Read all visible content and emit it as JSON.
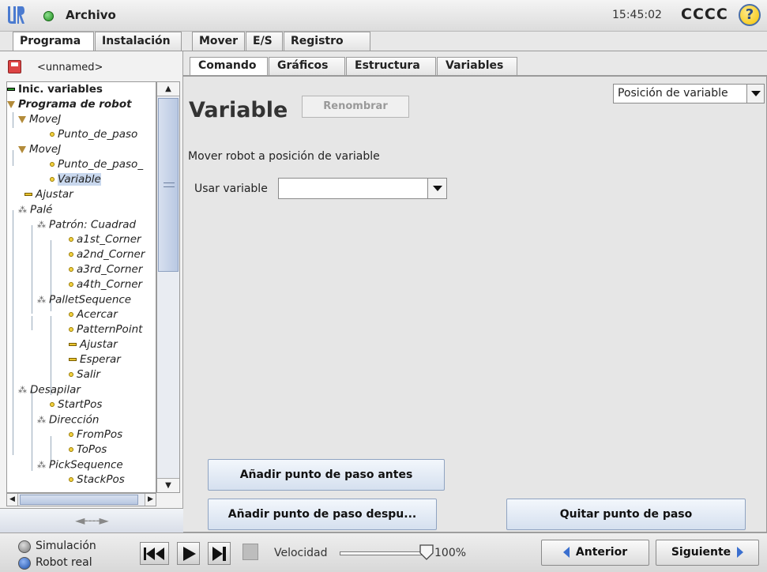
{
  "titlebar": {
    "app_title": "Archivo",
    "clock": "15:45:02",
    "robot_name": "CCCC",
    "help_label": "?"
  },
  "top_tabs": [
    "Programa",
    "Instalación",
    "Mover",
    "E/S",
    "Registro"
  ],
  "file": {
    "name": "<unnamed>"
  },
  "tree": [
    {
      "label": "Inic. variables"
    },
    {
      "label": "Programa de robot"
    },
    {
      "label": "MoveJ"
    },
    {
      "label": "Punto_de_paso"
    },
    {
      "label": "MoveJ"
    },
    {
      "label": "Punto_de_paso_"
    },
    {
      "label": "Variable"
    },
    {
      "label": "Ajustar"
    },
    {
      "label": "Palé"
    },
    {
      "label": "Patrón: Cuadrad"
    },
    {
      "label": "a1st_Corner"
    },
    {
      "label": "a2nd_Corner"
    },
    {
      "label": "a3rd_Corner"
    },
    {
      "label": "a4th_Corner"
    },
    {
      "label": "PalletSequence"
    },
    {
      "label": "Acercar"
    },
    {
      "label": "PatternPoint"
    },
    {
      "label": "Ajustar"
    },
    {
      "label": "Esperar"
    },
    {
      "label": "Salir"
    },
    {
      "label": "Desapilar"
    },
    {
      "label": "StartPos"
    },
    {
      "label": "Dirección"
    },
    {
      "label": "FromPos"
    },
    {
      "label": "ToPos"
    },
    {
      "label": "PickSequence"
    },
    {
      "label": "StackPos"
    }
  ],
  "collapse_label": "◄----►",
  "sub_tabs": [
    "Comando",
    "Gráficos",
    "Estructura",
    "Variables"
  ],
  "command": {
    "heading": "Variable",
    "rename_label": "Renombrar",
    "position_select": "Posición de variable",
    "description": "Mover robot a posición de variable",
    "use_variable_label": "Usar variable",
    "use_variable_value": "",
    "add_before_label": "Añadir punto de paso antes",
    "add_after_label": "Añadir punto de paso despu...",
    "remove_label": "Quitar punto de paso"
  },
  "bottom": {
    "simulation_label": "Simulación",
    "real_robot_label": "Robot real",
    "speed_label": "Velocidad",
    "speed_value": "100%",
    "speed_fraction": 1.0,
    "prev_label": "Anterior",
    "next_label": "Siguiente"
  },
  "colors": {
    "accent_blue": "#3a6fcf",
    "status_green": "#1f8f1f",
    "selected_bg": "#c9d8ee"
  }
}
